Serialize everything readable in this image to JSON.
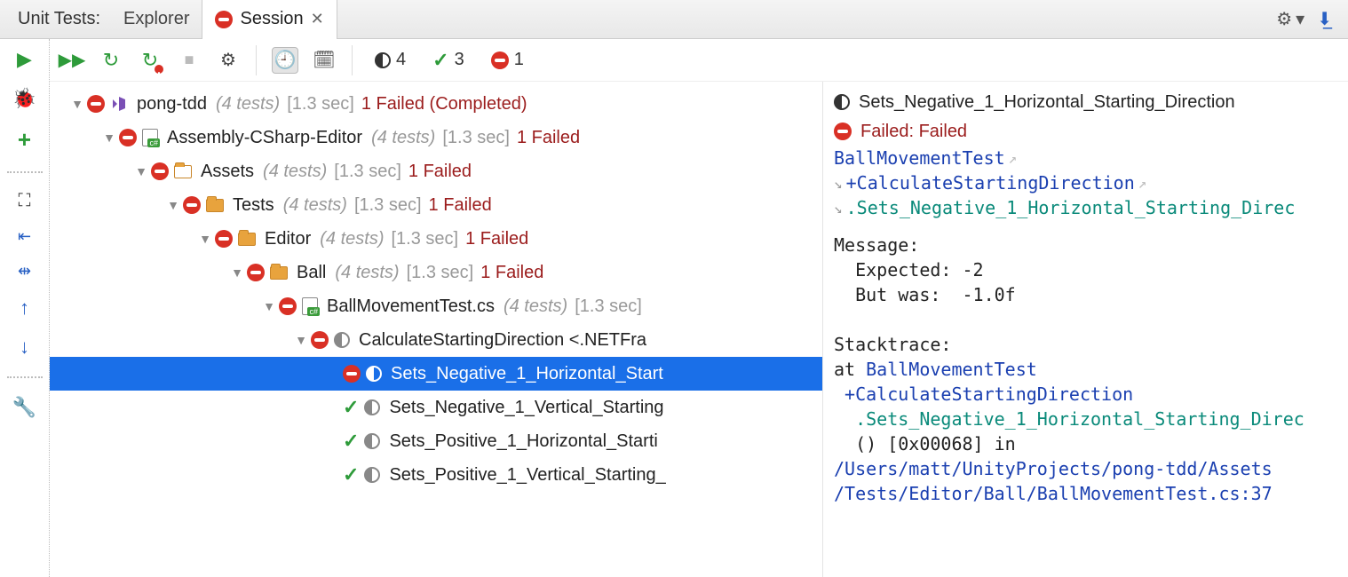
{
  "header": {
    "title": "Unit Tests:",
    "tabs": [
      {
        "label": "Explorer",
        "active": false
      },
      {
        "label": "Session",
        "active": true,
        "icon": "fail",
        "closable": true
      }
    ]
  },
  "summary": {
    "total": 4,
    "passed": 3,
    "failed": 1
  },
  "tree": [
    {
      "depth": 0,
      "status": "fail",
      "icon": "vs",
      "name": "pong-tdd",
      "meta": "(4 tests)",
      "time": "[1.3 sec]",
      "result": "1 Failed (Completed)"
    },
    {
      "depth": 1,
      "status": "fail",
      "icon": "cs",
      "name": "Assembly-CSharp-Editor",
      "meta": "(4 tests)",
      "time": "[1.3 sec]",
      "result": "1 Failed"
    },
    {
      "depth": 2,
      "status": "fail",
      "icon": "folder-assets",
      "name": "Assets",
      "meta": "(4 tests)",
      "time": "[1.3 sec]",
      "result": "1 Failed"
    },
    {
      "depth": 3,
      "status": "fail",
      "icon": "folder",
      "name": "Tests",
      "meta": "(4 tests)",
      "time": "[1.3 sec]",
      "result": "1 Failed"
    },
    {
      "depth": 4,
      "status": "fail",
      "icon": "folder",
      "name": "Editor",
      "meta": "(4 tests)",
      "time": "[1.3 sec]",
      "result": "1 Failed"
    },
    {
      "depth": 5,
      "status": "fail",
      "icon": "folder",
      "name": "Ball",
      "meta": "(4 tests)",
      "time": "[1.3 sec]",
      "result": "1 Failed"
    },
    {
      "depth": 6,
      "status": "fail",
      "icon": "cs",
      "name": "BallMovementTest.cs",
      "meta": "(4 tests)",
      "time": "[1.3 sec]",
      "result": ""
    },
    {
      "depth": 7,
      "status": "fail",
      "icon": "half",
      "name": "CalculateStartingDirection <.NETFra",
      "meta": "",
      "time": "",
      "result": ""
    },
    {
      "depth": 8,
      "status": "fail",
      "icon": "half",
      "name": "Sets_Negative_1_Horizontal_Start",
      "selected": true,
      "leaf": true
    },
    {
      "depth": 8,
      "status": "pass",
      "icon": "half",
      "name": "Sets_Negative_1_Vertical_Starting",
      "leaf": true
    },
    {
      "depth": 8,
      "status": "pass",
      "icon": "half",
      "name": "Sets_Positive_1_Horizontal_Starti",
      "leaf": true
    },
    {
      "depth": 8,
      "status": "pass",
      "icon": "half",
      "name": "Sets_Positive_1_Vertical_Starting_",
      "leaf": true
    }
  ],
  "details": {
    "title": "Sets_Negative_1_Horizontal_Starting_Direction",
    "status": "Failed: Failed",
    "path_class": "BallMovementTest",
    "path_method": "+CalculateStartingDirection",
    "path_test": ".Sets_Negative_1_Horizontal_Starting_Direc",
    "message_label": "Message:",
    "message_expected": "  Expected: -2",
    "message_actual": "  But was:  -1.0f",
    "stack_label": "Stacktrace:",
    "stack_at": "at ",
    "stack_class": "BallMovementTest",
    "stack_method": " +CalculateStartingDirection",
    "stack_test": "  .Sets_Negative_1_Horizontal_Starting_Direc",
    "stack_offset": "  () [0x00068] in",
    "stack_file1": "/Users/matt/UnityProjects/pong-tdd/Assets",
    "stack_file2": "/Tests/Editor/Ball/BallMovementTest.cs:37"
  }
}
